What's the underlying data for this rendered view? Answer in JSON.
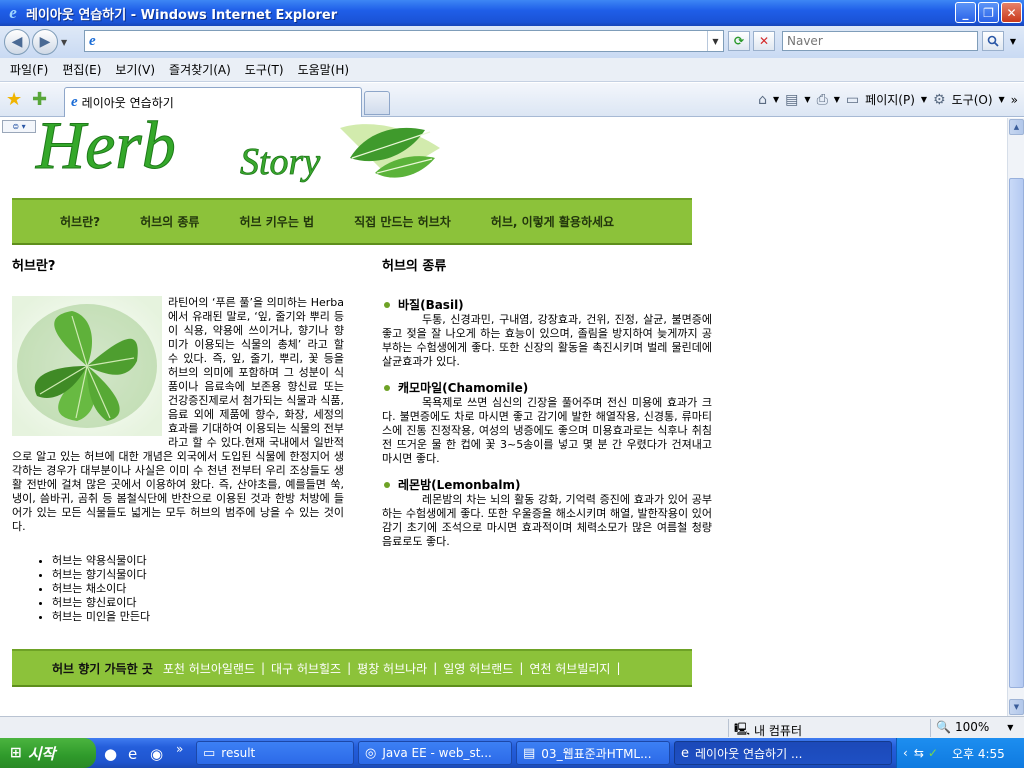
{
  "window": {
    "title": "레이아웃 연습하기 - Windows Internet Explorer"
  },
  "addressbar": {
    "url": "",
    "search_placeholder": "Naver"
  },
  "menubar": {
    "items": [
      "파일(F)",
      "편집(E)",
      "보기(V)",
      "즐겨찾기(A)",
      "도구(T)",
      "도움말(H)"
    ]
  },
  "tabs": {
    "active_label": "레이아웃 연습하기",
    "page_menu": "페이지(P)",
    "tools_menu": "도구(O)"
  },
  "page": {
    "logo_text_main": "Herb",
    "logo_text_sub": "Story",
    "nav": [
      "허브란?",
      "허브의 종류",
      "허브 키우는 법",
      "직접 만드는 허브차",
      "허브, 이렇게 활용하세요"
    ],
    "left": {
      "heading": "허브란?",
      "intro": "라틴어의 ‘푸른 풀’을 의미하는 Herba에서 유래된 말로, ‘잎, 줄기와 뿌리 등이 식용, 약용에 쓰이거나, 향기나 향미가 이용되는 식물의 총체’ 라고 할 수 있다. 즉, 잎, 줄기, 뿌리, 꽃 등을 허브의 의미에 포함하며 그 성분이 식품이나 음료속에 보존용 향신료 또는 건강증진제로서 첨가되는 식물과 식품, 음료 외에 제품에 향수, 화장, 세정의 효과를 기대하여 이용되는 식물의 전부라고 할 수 있다.현재 국내에서 일반적으로 알고 있는 허브에 대한 개념은 외국에서 도입된 식물에 한정지어 생각하는 경우가 대부분이나 사실은 이미 수 천년 전부터 우리 조상들도 생활 전반에 걸쳐 많은 곳에서 이용하여 왔다. 즉, 산야초를, 예를들면 쑥, 냉이, 씀바귀, 곰취 등 봄철식단에 반찬으로 이용된 것과 한방 처방에 들어가 있는 모든 식물들도 넓게는 모두 허브의 범주에 낭을 수 있는 것이다.",
      "list": [
        "허브는 약용식물이다",
        "허브는 향기식물이다",
        "허브는 채소이다",
        "허브는 향신료이다",
        "허브는 미인을 만든다"
      ]
    },
    "right": {
      "heading": "허브의 종류",
      "herbs": [
        {
          "name": "바질(Basil)",
          "desc": "두통, 신경과민, 구내염, 강장효과, 건위, 진정, 살균, 불면증에 좋고 젖을 잘 나오게 하는 효능이 있으며, 졸림을 방지하여 늦게까지 공부하는 수험생에게 좋다. 또한 신장의 활동을 촉진시키며 벌레 물린데에 살균효과가 있다."
        },
        {
          "name": "캐모마일(Chamomile)",
          "desc": "목욕제로 쓰면 심신의 긴장을 풀어주며 전신 미용에 효과가 크다. 불면증에도 차로 마시면 좋고 감기에 발한 해열작용, 신경통, 류마티스에 진통 진정작용, 여성의 냉증에도 좋으며 미용효과로는 식후나 취침 전 뜨거운 물 한 컵에 꽃 3~5송이를 넣고 몇 분 간 우렸다가 건져내고 마시면 좋다."
        },
        {
          "name": "레몬밤(Lemonbalm)",
          "desc": "레몬밤의 차는 뇌의 활동 강화, 기억력 증진에 효과가 있어 공부하는 수험생에게 좋다. 또한 우울증을 해소시키며 해열, 발한작용이 있어 감기 초기에 조석으로 마시면 효과적이며 체력소모가 많은 여름철 청량음료로도 좋다."
        }
      ]
    },
    "footer": {
      "title": "허브 향기 가득한 곳",
      "links": [
        "포천 허브아일랜드",
        "대구 허브힐즈",
        "평창 허브나라",
        "일영 허브랜드",
        "연천 허브빌리지"
      ]
    }
  },
  "statusbar": {
    "zone": "내 컴퓨터",
    "zoom": "100%"
  },
  "taskbar": {
    "start_label": "시작",
    "tasks": [
      "result",
      "Java EE - web_st...",
      "03_웹표준과HTML...",
      "레이아웃 연습하기 ..."
    ],
    "clock": "오후 4:55"
  }
}
